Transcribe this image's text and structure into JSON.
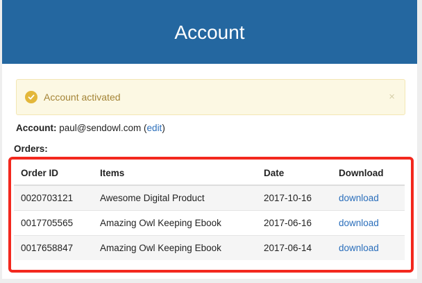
{
  "header": {
    "title": "Account"
  },
  "alert": {
    "icon": "check-circle-icon",
    "message": "Account activated",
    "close_glyph": "×"
  },
  "account": {
    "label": "Account:",
    "email": "paul@sendowl.com",
    "open_paren": "(",
    "edit_label": "edit",
    "close_paren": ")"
  },
  "orders": {
    "label": "Orders:",
    "columns": {
      "order_id": "Order ID",
      "items": "Items",
      "date": "Date",
      "download": "Download"
    },
    "rows": [
      {
        "order_id": "0020703121",
        "item": "Awesome Digital Product",
        "date": "2017-10-16",
        "download": "download"
      },
      {
        "order_id": "0017705565",
        "item": "Amazing Owl Keeping Ebook",
        "date": "2017-06-16",
        "download": "download"
      },
      {
        "order_id": "0017658847",
        "item": "Amazing Owl Keeping Ebook",
        "date": "2017-06-14",
        "download": "download"
      }
    ]
  },
  "colors": {
    "header_bg": "#2467a0",
    "alert_bg": "#fcf8e3",
    "alert_text": "#a48436",
    "link": "#2a6ebb",
    "highlight_border": "#f3281e"
  }
}
